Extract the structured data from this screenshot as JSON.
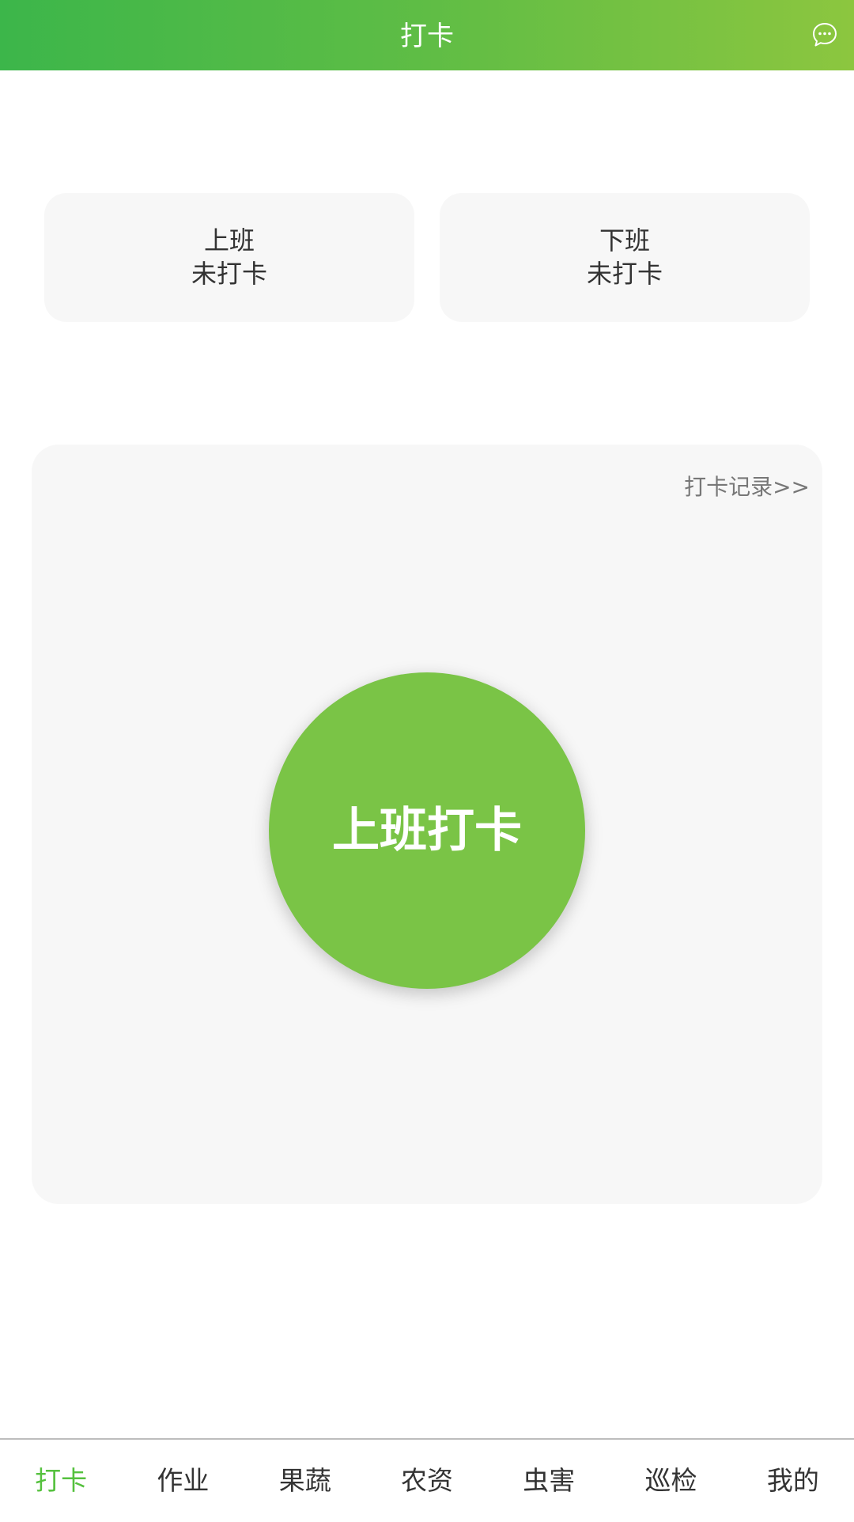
{
  "header": {
    "title": "打卡",
    "message_icon": "chat-bubble-icon"
  },
  "status_cards": [
    {
      "label": "上班",
      "status": "未打卡"
    },
    {
      "label": "下班",
      "status": "未打卡"
    }
  ],
  "punch_panel": {
    "record_link": "打卡记录>>",
    "button_label": "上班打卡"
  },
  "bottom_nav": {
    "items": [
      {
        "label": "打卡",
        "active": true
      },
      {
        "label": "作业",
        "active": false
      },
      {
        "label": "果蔬",
        "active": false
      },
      {
        "label": "农资",
        "active": false
      },
      {
        "label": "虫害",
        "active": false
      },
      {
        "label": "巡检",
        "active": false
      },
      {
        "label": "我的",
        "active": false
      }
    ]
  },
  "colors": {
    "header_gradient_start": "#3cb64a",
    "header_gradient_end": "#8cc63f",
    "punch_button": "#7ac446",
    "nav_active": "#55c13e",
    "card_background": "#f7f7f7"
  }
}
